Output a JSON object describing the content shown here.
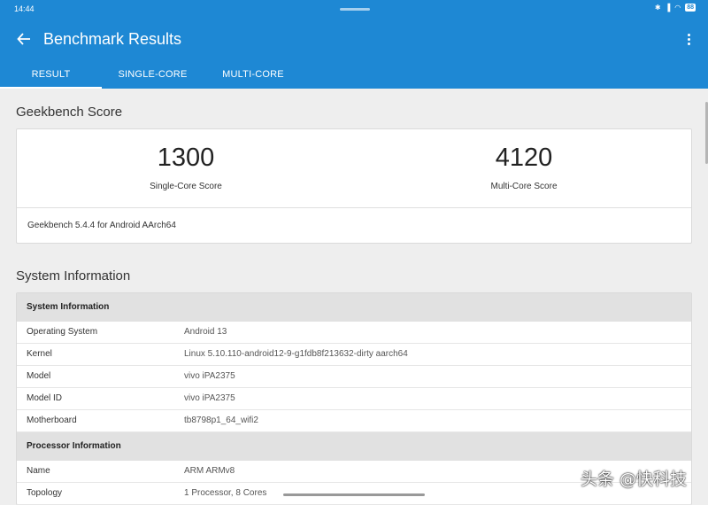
{
  "status_bar": {
    "time": "14:44",
    "battery": "88"
  },
  "app_bar": {
    "title": "Benchmark Results"
  },
  "tabs": [
    {
      "label": "RESULT"
    },
    {
      "label": "SINGLE-CORE"
    },
    {
      "label": "MULTI-CORE"
    }
  ],
  "score_section": {
    "title": "Geekbench Score",
    "single_core_score": "1300",
    "single_core_label": "Single-Core Score",
    "multi_core_score": "4120",
    "multi_core_label": "Multi-Core Score",
    "version": "Geekbench 5.4.4 for Android AArch64"
  },
  "system_section": {
    "title": "System Information",
    "system_header": "System Information",
    "rows": [
      {
        "key": "Operating System",
        "value": "Android 13"
      },
      {
        "key": "Kernel",
        "value": "Linux 5.10.110-android12-9-g1fdb8f213632-dirty aarch64"
      },
      {
        "key": "Model",
        "value": "vivo iPA2375"
      },
      {
        "key": "Model ID",
        "value": "vivo iPA2375"
      },
      {
        "key": "Motherboard",
        "value": "tb8798p1_64_wifi2"
      }
    ],
    "processor_header": "Processor Information",
    "processor_rows": [
      {
        "key": "Name",
        "value": "ARM ARMv8"
      },
      {
        "key": "Topology",
        "value": "1 Processor, 8 Cores"
      }
    ]
  },
  "watermark": "头条 @快科技",
  "colors": {
    "app_bar": "#1e88d4",
    "background": "#eeeeee",
    "header_row": "#e1e1e1"
  }
}
